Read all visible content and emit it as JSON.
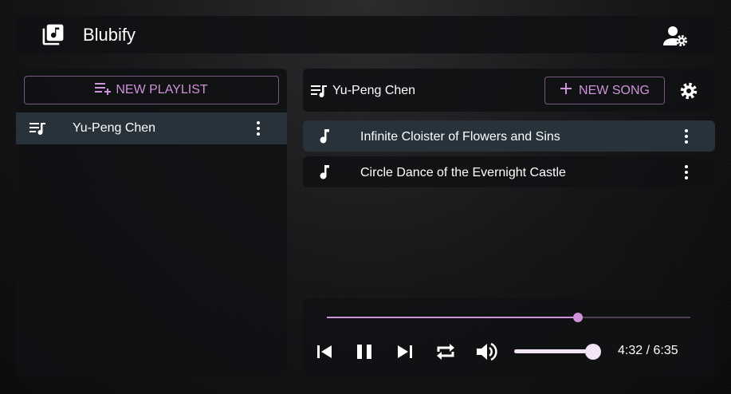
{
  "app": {
    "title": "Blubify",
    "logo_icon": "music-library-icon",
    "account_icon": "account-settings-icon"
  },
  "sidebar": {
    "new_playlist_label": "NEW PLAYLIST",
    "playlists": [
      {
        "label": "Yu-Peng Chen",
        "selected": true
      }
    ]
  },
  "playlist_view": {
    "title": "Yu-Peng Chen",
    "new_song_label": "NEW SONG",
    "songs": [
      {
        "title": "Infinite Cloister of Flowers and Sins",
        "selected": true
      },
      {
        "title": "Circle Dance of the Evernight Castle",
        "selected": false
      }
    ]
  },
  "player": {
    "progress": 0.69,
    "volume": 0.99,
    "time": "4:32 / 6:35",
    "state": "playing"
  },
  "colors": {
    "accent": "#ce93d8",
    "track_inactive": "#4d3f52",
    "selected_row": "#27323a"
  }
}
